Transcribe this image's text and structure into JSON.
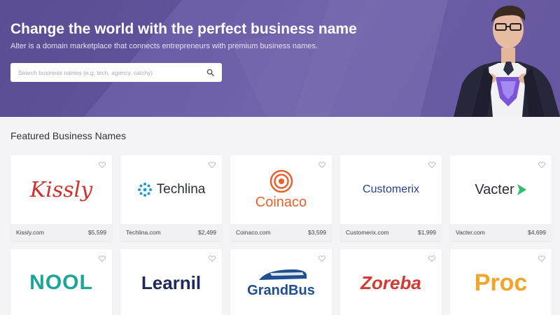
{
  "hero": {
    "title": "Change the world with the perfect business name",
    "subtitle": "Alter is a domain marketplace that connects entrepreneurs with premium business names.",
    "search_placeholder": "Search business names (e.g. tech, agency, catchy)"
  },
  "featured": {
    "title": "Featured Business Names",
    "cards": [
      {
        "logo_text": "Kissly",
        "domain": "Kissly.com",
        "price": "$5,599",
        "color": "#d0302f"
      },
      {
        "logo_text": "Techlina",
        "domain": "Techlina.com",
        "price": "$2,499",
        "color": "#2b2f3a",
        "accent": "#1f9bd8"
      },
      {
        "logo_text": "Coinaco",
        "domain": "Coinaco.com",
        "price": "$3,599",
        "color": "#e8612d"
      },
      {
        "logo_text": "Customerix",
        "domain": "Customerix.com",
        "price": "$1,999",
        "color": "#2a3f8f",
        "accent": "#2fb7a8"
      },
      {
        "logo_text": "Vacter",
        "domain": "Vacter.com",
        "price": "$4,699",
        "color": "#2b2f3a",
        "accent": "#2fbf71"
      },
      {
        "logo_text": "NOOL",
        "color": "#1aa79a"
      },
      {
        "logo_text": "Learnil",
        "color": "#1f2a5a",
        "accent": "#d82f3b"
      },
      {
        "logo_text": "GrandBus",
        "color": "#1f4f8f"
      },
      {
        "logo_text": "Zoreba",
        "color": "#d33b32"
      },
      {
        "logo_text": "Proc",
        "color": "#f2a527"
      }
    ]
  },
  "colors": {
    "hero_bg": "#6a5ca3",
    "card_footer_bg": "#f1f1f3"
  }
}
